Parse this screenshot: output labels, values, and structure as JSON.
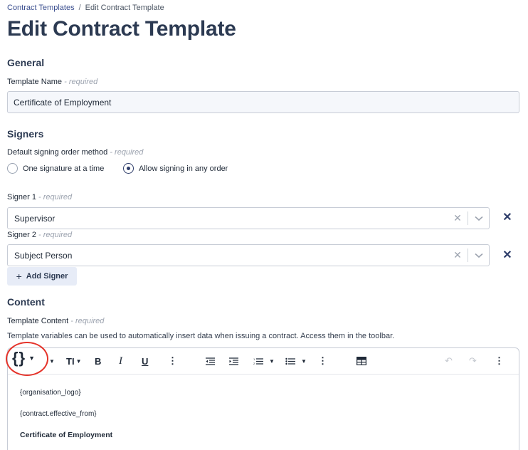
{
  "breadcrumb": {
    "parent": "Contract Templates",
    "separator": "/",
    "current": "Edit Contract Template"
  },
  "page_title": "Edit Contract Template",
  "general": {
    "heading": "General",
    "template_name_label": "Template Name",
    "required_text": "- required",
    "template_name_value": "Certificate of Employment"
  },
  "signers": {
    "heading": "Signers",
    "order_label": "Default signing order method",
    "required_text": "- required",
    "options": [
      "One signature at a time",
      "Allow signing in any order"
    ],
    "selected_option": "Allow signing in any order",
    "signer1_label": "Signer 1",
    "signer1_value": "Supervisor",
    "signer2_label": "Signer 2",
    "signer2_value": "Subject Person",
    "add_signer_label": "Add Signer"
  },
  "content": {
    "heading": "Content",
    "template_content_label": "Template Content",
    "required_text": "- required",
    "help_text": "Template variables can be used to automatically insert data when issuing a contract. Access them in the toolbar.",
    "editor_lines": [
      "{organisation_logo}",
      "{contract.effective_from}",
      "Certificate of Employment"
    ]
  },
  "toolbar_icons": [
    "variables-icon",
    "font-color-icon",
    "font-size-icon",
    "bold-icon",
    "italic-icon",
    "underline-icon",
    "more-icon",
    "outdent-icon",
    "indent-icon",
    "ordered-list-icon",
    "bullet-list-icon",
    "table-icon",
    "undo-icon",
    "redo-icon"
  ],
  "colors": {
    "accent": "#2f3e6b",
    "annotation": "#e5332a",
    "button_bg": "#e7ecf7"
  }
}
